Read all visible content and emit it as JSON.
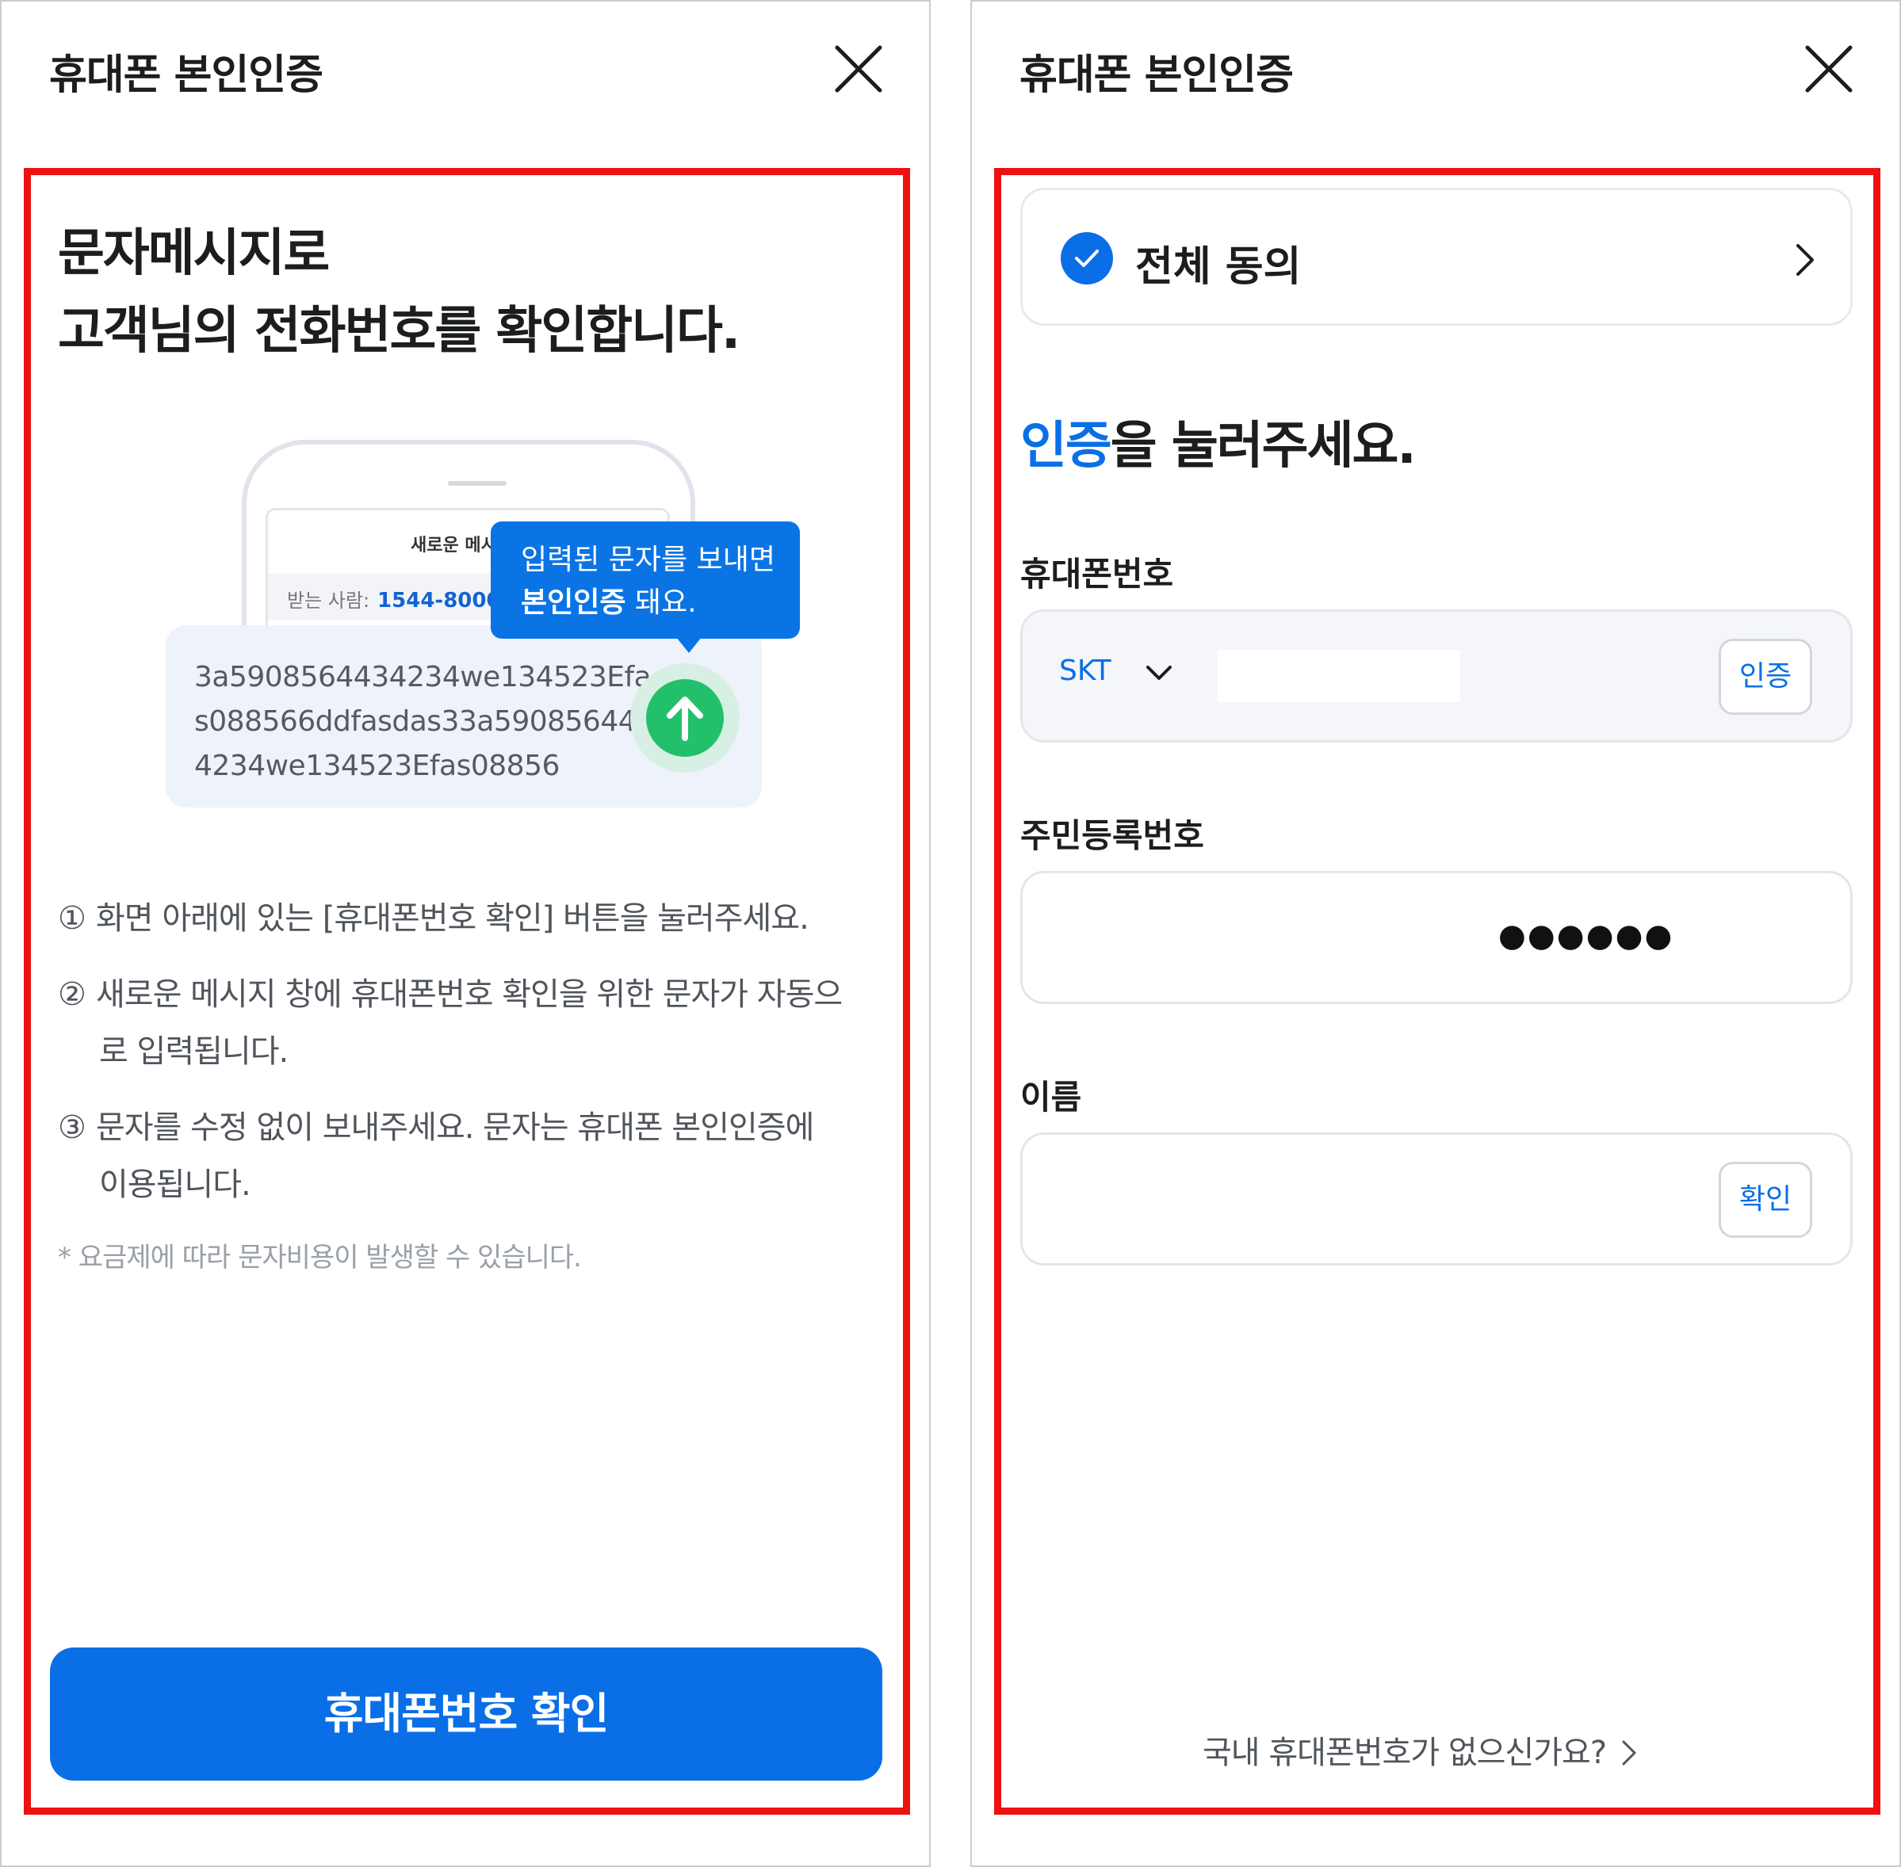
{
  "left": {
    "header_title": "휴대폰 본인인증",
    "headline_line1": "문자메시지로",
    "headline_line2": "고객님의 전화번호를 확인합니다.",
    "illustration": {
      "card_title": "새로운 메시",
      "to_label": "받는 사람:",
      "to_number": "1544-8000",
      "tooltip_line1": "입력된 문자를 보내면",
      "tooltip_line2_bold": "본인인증",
      "tooltip_line2_rest": " 돼요.",
      "message_line1": "3a5908564434234we134523Efa",
      "message_line2": "s088566ddfasdas33a590856443",
      "message_line3": "4234we134523Efas08856"
    },
    "instructions": [
      {
        "num": "①",
        "line1": "화면 아래에 있는 [휴대폰번호 확인] 버튼을 눌러주세요.",
        "line2": ""
      },
      {
        "num": "②",
        "line1": "새로운 메시지 창에 휴대폰번호 확인을 위한 문자가 자동으",
        "line2": "로 입력됩니다."
      },
      {
        "num": "③",
        "line1": "문자를 수정 없이 보내주세요. 문자는 휴대폰 본인인증에",
        "line2": "이용됩니다."
      }
    ],
    "footnote": "* 요금제에 따라 문자비용이 발생할 수 있습니다.",
    "primary_button": "휴대폰번호 확인"
  },
  "right": {
    "header_title": "휴대폰 본인인증",
    "agree_label": "전체 동의",
    "headline_accent": "인증",
    "headline_rest": "을 눌러주세요.",
    "phone_label": "휴대폰번호",
    "carrier": "SKT",
    "phone_value": "",
    "verify_button": "인증",
    "rrn_label": "주민등록번호",
    "rrn_masked": "●●●●●●",
    "name_label": "이름",
    "name_value": "",
    "confirm_button": "확인",
    "footer_link": "국내 휴대폰번호가 없으신가요?"
  },
  "colors": {
    "accent": "#0a6fe6",
    "frame": "#ee1111",
    "send": "#23c06b"
  },
  "icons": [
    "close-icon",
    "send-arrow-icon",
    "check-icon",
    "chevron-right-icon",
    "chevron-down-icon"
  ]
}
